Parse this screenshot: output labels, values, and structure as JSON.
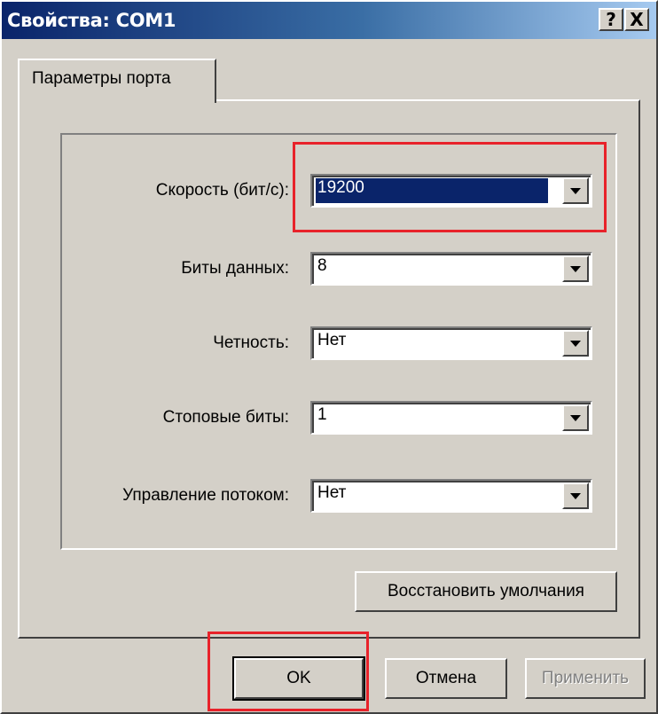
{
  "window": {
    "title": "Свойства: COM1",
    "help_label": "?",
    "close_label": "X"
  },
  "tabs": [
    {
      "label": "Параметры порта",
      "active": true
    }
  ],
  "settings": [
    {
      "label": "Скорость (бит/с):",
      "value": "19200",
      "selected": true
    },
    {
      "label": "Биты данных:",
      "value": "8",
      "selected": false
    },
    {
      "label": "Четность:",
      "value": "Нет",
      "selected": false
    },
    {
      "label": "Стоповые биты:",
      "value": "1",
      "selected": false
    },
    {
      "label": "Управление потоком:",
      "value": "Нет",
      "selected": false
    }
  ],
  "restore_defaults_label": "Восстановить умолчания",
  "buttons": {
    "ok_label": "OK",
    "cancel_label": "Отмена",
    "apply_label": "Применить",
    "apply_enabled": false
  },
  "colors": {
    "face": "#d4d0c8",
    "selection": "#0a246a",
    "annotation": "#e8222a"
  }
}
